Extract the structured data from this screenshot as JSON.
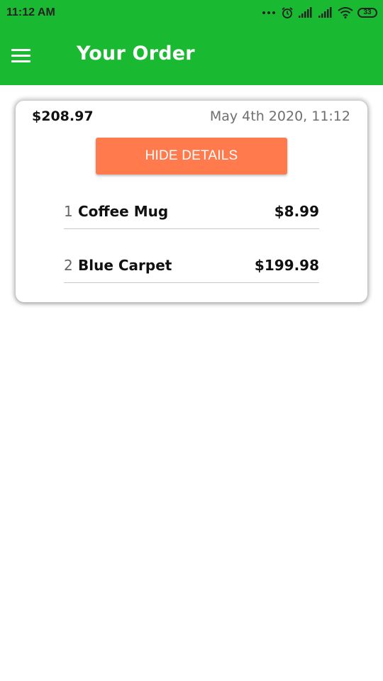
{
  "status_bar": {
    "time": "11:12 AM",
    "battery": "33",
    "icons": [
      "more-dots-icon",
      "alarm-icon",
      "signal-icon",
      "signal-icon",
      "wifi-icon",
      "battery-icon"
    ]
  },
  "app_bar": {
    "title": "Your Order",
    "color": "#1ab932",
    "menu_icon": "hamburger-menu-icon"
  },
  "order": {
    "total": "$208.97",
    "date": "May 4th 2020, 11:12",
    "toggle_label": "HIDE DETAILS",
    "toggle_color": "#ff7a4c",
    "items": [
      {
        "number": "1",
        "name": "Coffee Mug",
        "price": "$8.99"
      },
      {
        "number": "2",
        "name": "Blue Carpet",
        "price": "$199.98"
      }
    ]
  }
}
